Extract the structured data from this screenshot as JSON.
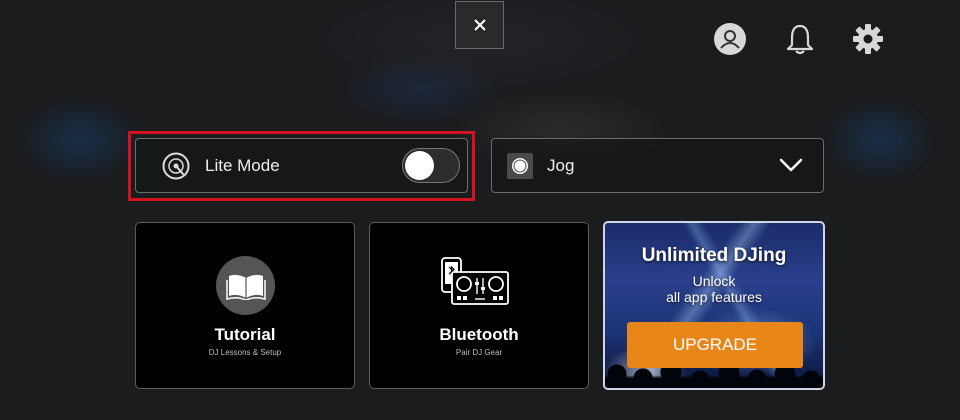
{
  "top_bar": {
    "close_icon": "close-icon",
    "profile_icon": "user-avatar-icon",
    "notifications_icon": "bell-icon",
    "settings_icon": "gear-icon"
  },
  "lite_mode": {
    "icon": "turntable-disc-icon",
    "label": "Lite Mode",
    "toggle_on": false
  },
  "jog_select": {
    "icon": "jog-wheel-icon",
    "selected_value": "Jog",
    "chevron_icon": "chevron-down-icon"
  },
  "tiles": {
    "tutorial": {
      "icon": "book-icon",
      "title": "Tutorial",
      "subtitle": "DJ Lessons & Setup"
    },
    "bluetooth": {
      "icon": "phone-dj-controller-icon",
      "title": "Bluetooth",
      "subtitle": "Pair DJ Gear"
    },
    "upgrade": {
      "title": "Unlimited DJing",
      "line1": "Unlock",
      "line2": "all app features",
      "button_label": "UPGRADE"
    }
  },
  "colors": {
    "highlight_border": "#d4121e",
    "upgrade_button": "#e8861a",
    "background": "#1b1c1e"
  }
}
